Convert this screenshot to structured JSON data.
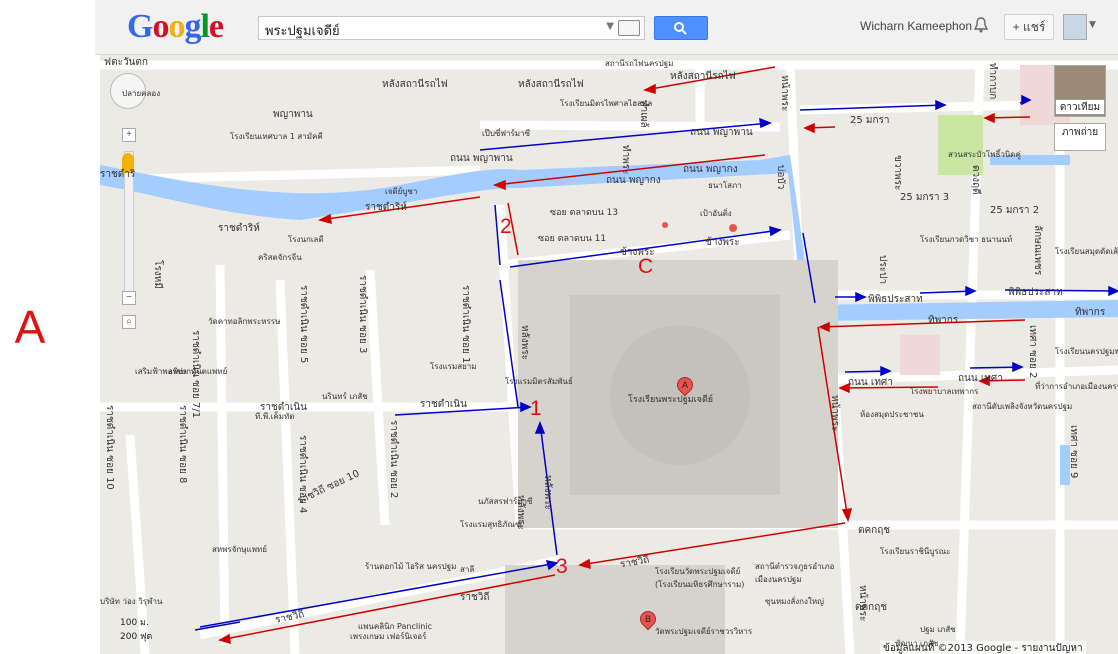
{
  "side_label": "A",
  "header": {
    "logo": [
      "G",
      "o",
      "o",
      "g",
      "l",
      "e"
    ],
    "search_value": "พระปฐมเจดีย์",
    "user_name": "Wicharn Kameephon",
    "share_label": "+ แชร์"
  },
  "map_controls": {
    "satellite_label": "ดาวเทียม",
    "photos_label": "ภาพถ่าย",
    "scale_m": "100 ม.",
    "scale_ft": "200 ฟุต",
    "footer": "ข้อมูลแผนที่ ©2013 Google - รายงานปัญหา"
  },
  "route_numbers": [
    "1",
    "2",
    "3"
  ],
  "markers": {
    "a": "A",
    "b": "B",
    "c": "C"
  },
  "labels": [
    "ฟตะวันตก",
    "หลังสถานีรถไฟ",
    "หลังสถานีรถไฟ",
    "หลังสถานีรถไฟ",
    "สถานีรถไฟนครปฐม",
    "โรงเรียนมิตรไพศาลไฮสคูล",
    "ปลายคลอง",
    "พญาพาน",
    "โรงเรียนเทศบาล 1 สามัคคี",
    "เป๊บซี่ฟาร์มาซี",
    "ถนน พญาพาน",
    "ถนน พญาพาน",
    "ถนน พญากง",
    "ถนน พญากง",
    "ธนาโสภา",
    "ซอย ตลาดบน 13",
    "ซอย ตลาดบน 11",
    "เป้าอันติ่ง",
    "ข้างพระ",
    "ข้างพระ",
    "ราชดำริห์",
    "ราชดำริห์",
    "โรงนกเลดี",
    "คริสตจักรจีน",
    "ราชดำริ",
    "เจดีย์บูชา",
    "25 มกรา",
    "25 มกรา 3",
    "25 มกรา 2",
    "โรงเรียนกวดวิชา ธนานนท์",
    "โรงเรียนสมุดดัดเส้นโรงสี",
    "สวนสระบัวโพธิ์วนิดคู่",
    "พิพิธประสาท",
    "พิพิธประสาท",
    "ทิพากร",
    "ทิพากร",
    "ถนน เทศา",
    "ถนน เทศา",
    "โรงพยาบาลเทพากร",
    "ที่ว่าการอำเภอเมืองนครปฐม",
    "โรงเรียนนครปฐมพรหม",
    "สถานีดับเพลิงจังหวัดนครปฐม",
    "ห้องสมุดประชาชน",
    "โรงเรียนพระปฐมเจดีย์",
    "วัดคาทอลิกพระหรรษ",
    "โรงแรมสยาม",
    "โรงแรมมิตรสัมพันธ์",
    "ราชดำเนิน",
    "ราชดำเนิน",
    "นรินทร์ เภสัช",
    "ที.พี.เค็มทัต",
    "เสริมฟ้าพลาซ่า",
    "อพิเษกทันตแพทย์",
    "ราชดำเนิน ซอย 10",
    "ราชดำเนิน ซอย 8",
    "ราชดำเนิน ซอย 4",
    "ราชดำเนิน ซอย 2",
    "ราชวิถี ซอย 10",
    "นภัสสรฟาร์มาซี",
    "โรงแรมสุทธิภัณฑ์",
    "สหพรจักษุแพทย์",
    "ร้านดอกไม้ ไอริส นครปฐม",
    "สาลี",
    "ราชวิถี",
    "ราชวิถี",
    "ราชวิถี",
    "โรงเรียนวัดพระปฐมเจดีย์ (โรงเรียนมหิธรศึกษาราม)",
    "สถานีตำรวจภูธรอำเภอเมืองนครปฐม",
    "ซุนหมงลั่งกงใหญ่",
    "วัดพระปฐมเจดีย์ราชวรวิหาร",
    "โรงเรียนราชินีบูรณะ",
    "ตคกฤช",
    "ตคกฤช",
    "ปฐม เภสัช",
    "พัฒนา เภสัช",
    "เพรงเกษม เฟอร์นิเจอร์",
    "แพนคลินิก Panclinic",
    "บริษัท ว่อง วิรุฬ่าน",
    "หลังพระ",
    "หลังพระ",
    "หน้าพระ",
    "หน้าพระ",
    "หน้าพระ",
    "ขวาพระ",
    "ทำกาบก",
    "ทำเผล้",
    "ทำพระ",
    "บ่อบัว",
    "ดวงฤดี",
    "โรงหมี",
    "ประปา",
    "ลักษณเพชร",
    "เทศา ซอย 2",
    "เทศา ซอย 9",
    "หลังพระ",
    "ราชดำเนิน ซอย 5",
    "ราชดำเนิน ซอย 3",
    "ราชดำเนิน ซอย 1",
    "ราชดำเนิน ซอย 7/1"
  ]
}
